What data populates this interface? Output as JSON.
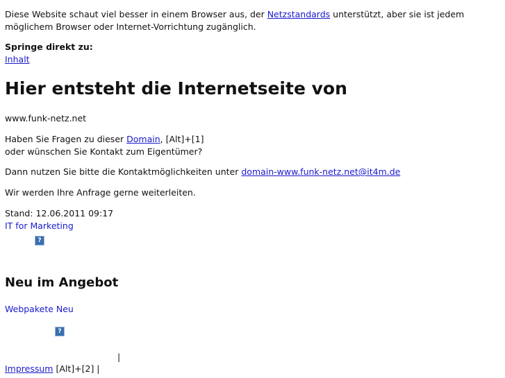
{
  "intro": {
    "text_before": "Diese Website schaut viel besser in einem Browser aus, der ",
    "link": "Netzstandards",
    "text_after": " unterstützt, aber sie ist jedem möglichem Browser oder Internet-Vorrichtung zugänglich."
  },
  "jump": {
    "title": "Springe direkt zu:",
    "link": "Inhalt"
  },
  "heading": "Hier entsteht die Internetseite von",
  "domain_name": "www.funk-netz.net",
  "questions": {
    "text_before": "Haben Sie Fragen zu dieser ",
    "link": "Domain",
    "access_key": ", [Alt]+[1]",
    "line2": "oder wünschen Sie Kontakt zum Eigentümer?"
  },
  "contact": {
    "text": "Dann nutzen Sie bitte die Kontaktmöglichkeiten unter ",
    "email": "domain-www.funk-netz.net@it4m.de"
  },
  "forward_text": "Wir werden Ihre Anfrage gerne weiterleiten.",
  "stand": "Stand: 12.06.2011 09:17",
  "it_marketing": "IT for Marketing",
  "icon_glyph": "?",
  "offer": {
    "heading": "Neu im Angebot",
    "link": "Webpakete Neu"
  },
  "separator": "|",
  "footer": {
    "impressum": "Impressum",
    "impressum_key": " [Alt]+[2] |"
  }
}
